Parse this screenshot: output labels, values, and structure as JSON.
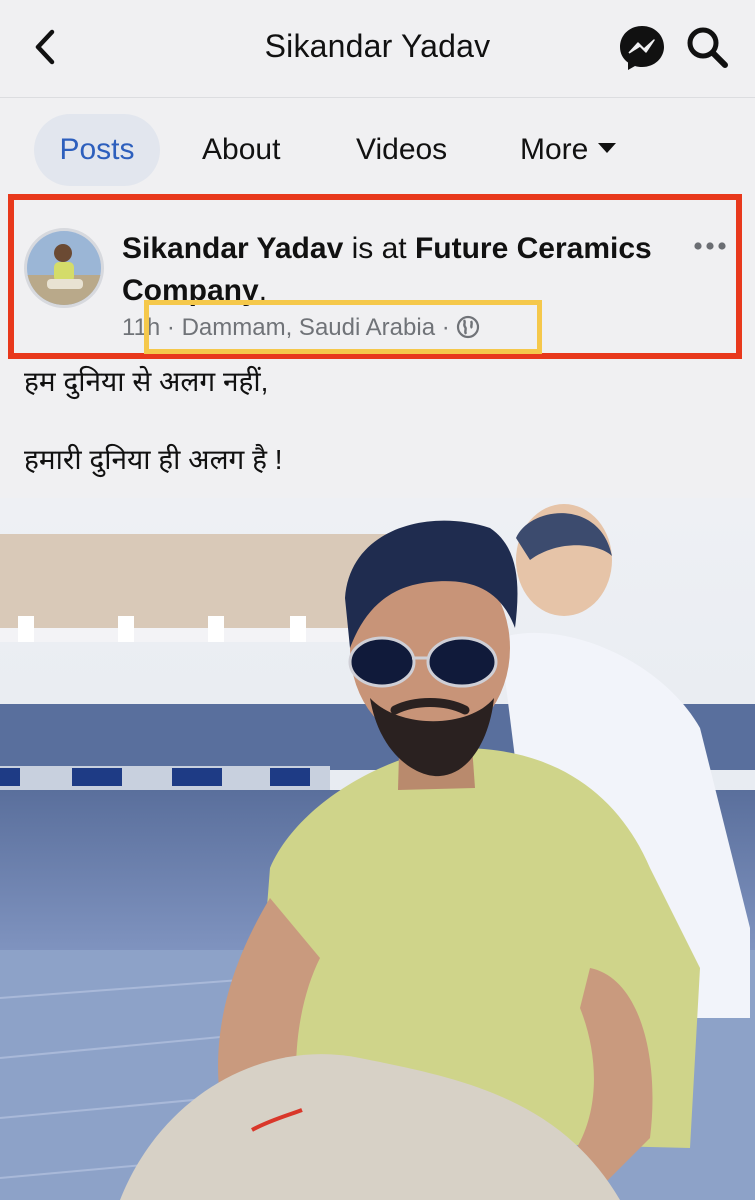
{
  "header": {
    "title": "Sikandar Yadav",
    "back_icon": "chevron-left-icon",
    "messenger_icon": "messenger-icon",
    "search_icon": "search-icon"
  },
  "tabs": [
    {
      "label": "Posts",
      "active": true
    },
    {
      "label": "About",
      "active": false
    },
    {
      "label": "Videos",
      "active": false
    },
    {
      "label": "More",
      "active": false
    }
  ],
  "post": {
    "author": "Sikandar Yadav",
    "connector": " is at ",
    "place": "Future Ceramics Company",
    "place_suffix": ".",
    "time": "11h",
    "location": "Dammam, Saudi Arabia",
    "separator": " · ",
    "privacy_icon": "globe-icon",
    "menu_icon": "more-horizontal-icon",
    "caption_line1": "हम दुनिया से अलग नहीं,",
    "caption_line2": "हमारी दुनिया ही अलग है !"
  },
  "colors": {
    "active_tab_text": "#2d5fbd",
    "active_tab_bg": "#e2e6ee",
    "highlight_red": "#e8381c",
    "highlight_yellow": "#f5c84b",
    "bar_bg": "#f0f0f2"
  }
}
